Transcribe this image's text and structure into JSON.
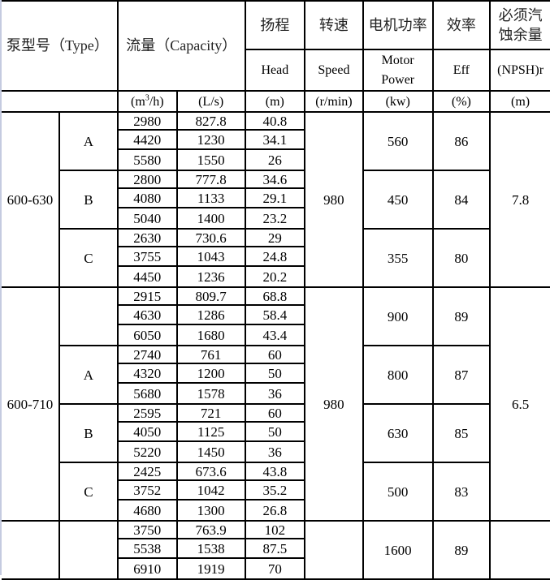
{
  "headers": {
    "type_label": "泵型号（Type）",
    "capacity_label": "流量（Capacity）",
    "head_cn": "扬程",
    "speed_cn": "转速",
    "power_cn": "电机功率",
    "eff_cn": "效率",
    "npsh_cn": "必须汽蚀余量",
    "head_en": "Head",
    "speed_en": "Speed",
    "power_en": "Motor Power",
    "eff_en": "Eff",
    "npsh_en": "(NPSH)r",
    "units": {
      "flow_m3h_pre": "(m",
      "flow_m3h_sup": "3",
      "flow_m3h_post": "/h)",
      "flow_ls": "(L/s)",
      "head": "(m)",
      "speed": "(r/min)",
      "power": "(kw)",
      "eff": "(%)",
      "npsh": "(m)"
    }
  },
  "models": [
    {
      "model": "600-630",
      "speed": "980",
      "npsh": "7.8",
      "variants": [
        {
          "impeller": "A",
          "power": "560",
          "eff": "86",
          "rows": [
            [
              "2980",
              "827.8",
              "40.8"
            ],
            [
              "4420",
              "1230",
              "34.1"
            ],
            [
              "5580",
              "1550",
              "26"
            ]
          ]
        },
        {
          "impeller": "B",
          "power": "450",
          "eff": "84",
          "rows": [
            [
              "2800",
              "777.8",
              "34.6"
            ],
            [
              "4080",
              "1133",
              "29.1"
            ],
            [
              "5040",
              "1400",
              "23.2"
            ]
          ]
        },
        {
          "impeller": "C",
          "power": "355",
          "eff": "80",
          "rows": [
            [
              "2630",
              "730.6",
              "29"
            ],
            [
              "3755",
              "1043",
              "24.8"
            ],
            [
              "4450",
              "1236",
              "20.2"
            ]
          ]
        }
      ]
    },
    {
      "model": "600-710",
      "speed": "980",
      "npsh": "6.5",
      "variants": [
        {
          "impeller": "",
          "power": "900",
          "eff": "89",
          "rows": [
            [
              "2915",
              "809.7",
              "68.8"
            ],
            [
              "4630",
              "1286",
              "58.4"
            ],
            [
              "6050",
              "1680",
              "43.4"
            ]
          ]
        },
        {
          "impeller": "A",
          "power": "800",
          "eff": "87",
          "rows": [
            [
              "2740",
              "761",
              "60"
            ],
            [
              "4320",
              "1200",
              "50"
            ],
            [
              "5680",
              "1578",
              "36"
            ]
          ]
        },
        {
          "impeller": "B",
          "power": "630",
          "eff": "85",
          "rows": [
            [
              "2595",
              "721",
              "60"
            ],
            [
              "4050",
              "1125",
              "50"
            ],
            [
              "5220",
              "1450",
              "36"
            ]
          ]
        },
        {
          "impeller": "C",
          "power": "500",
          "eff": "83",
          "rows": [
            [
              "2425",
              "673.6",
              "43.8"
            ],
            [
              "3752",
              "1042",
              "35.2"
            ],
            [
              "4680",
              "1300",
              "26.8"
            ]
          ]
        }
      ]
    },
    {
      "model": "",
      "speed": "",
      "npsh": "",
      "variants": [
        {
          "impeller": "",
          "power": "1600",
          "eff": "89",
          "rows": [
            [
              "3750",
              "763.9",
              "102"
            ],
            [
              "5538",
              "1538",
              "87.5"
            ],
            [
              "6910",
              "1919",
              "70"
            ]
          ]
        }
      ]
    }
  ]
}
